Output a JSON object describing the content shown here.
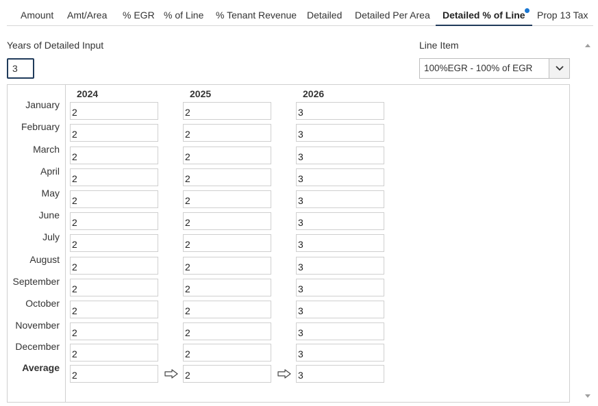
{
  "tabs": [
    {
      "label": "Amount"
    },
    {
      "label": "Amt/Area"
    },
    {
      "label": "% EGR"
    },
    {
      "label": "% of Line"
    },
    {
      "label": "% Tenant Revenue"
    },
    {
      "label": "Detailed"
    },
    {
      "label": "Detailed Per Area"
    },
    {
      "label": "Detailed % of Line",
      "active": true,
      "badge": "modified-dot"
    },
    {
      "label": "Prop 13 Tax"
    }
  ],
  "years_input": {
    "label": "Years of Detailed Input",
    "value": "3"
  },
  "line_item": {
    "label": "Line Item",
    "selected": "100%EGR - 100% of EGR"
  },
  "grid": {
    "years": [
      "2024",
      "2025",
      "2026"
    ],
    "months": [
      "January",
      "February",
      "March",
      "April",
      "May",
      "June",
      "July",
      "August",
      "September",
      "October",
      "November",
      "December"
    ],
    "values": {
      "2024": [
        "2",
        "2",
        "2",
        "2",
        "2",
        "2",
        "2",
        "2",
        "2",
        "2",
        "2",
        "2"
      ],
      "2025": [
        "2",
        "2",
        "2",
        "2",
        "2",
        "2",
        "2",
        "2",
        "2",
        "2",
        "2",
        "2"
      ],
      "2026": [
        "3",
        "3",
        "3",
        "3",
        "3",
        "3",
        "3",
        "3",
        "3",
        "3",
        "3",
        "3"
      ]
    },
    "average_label": "Average",
    "averages": [
      "2",
      "2",
      "3"
    ],
    "copy_arrow_icon": "right-arrow-icon"
  },
  "colors": {
    "accent": "#1f3a5a",
    "badge": "#1976d2",
    "border": "#cfcfcf"
  }
}
